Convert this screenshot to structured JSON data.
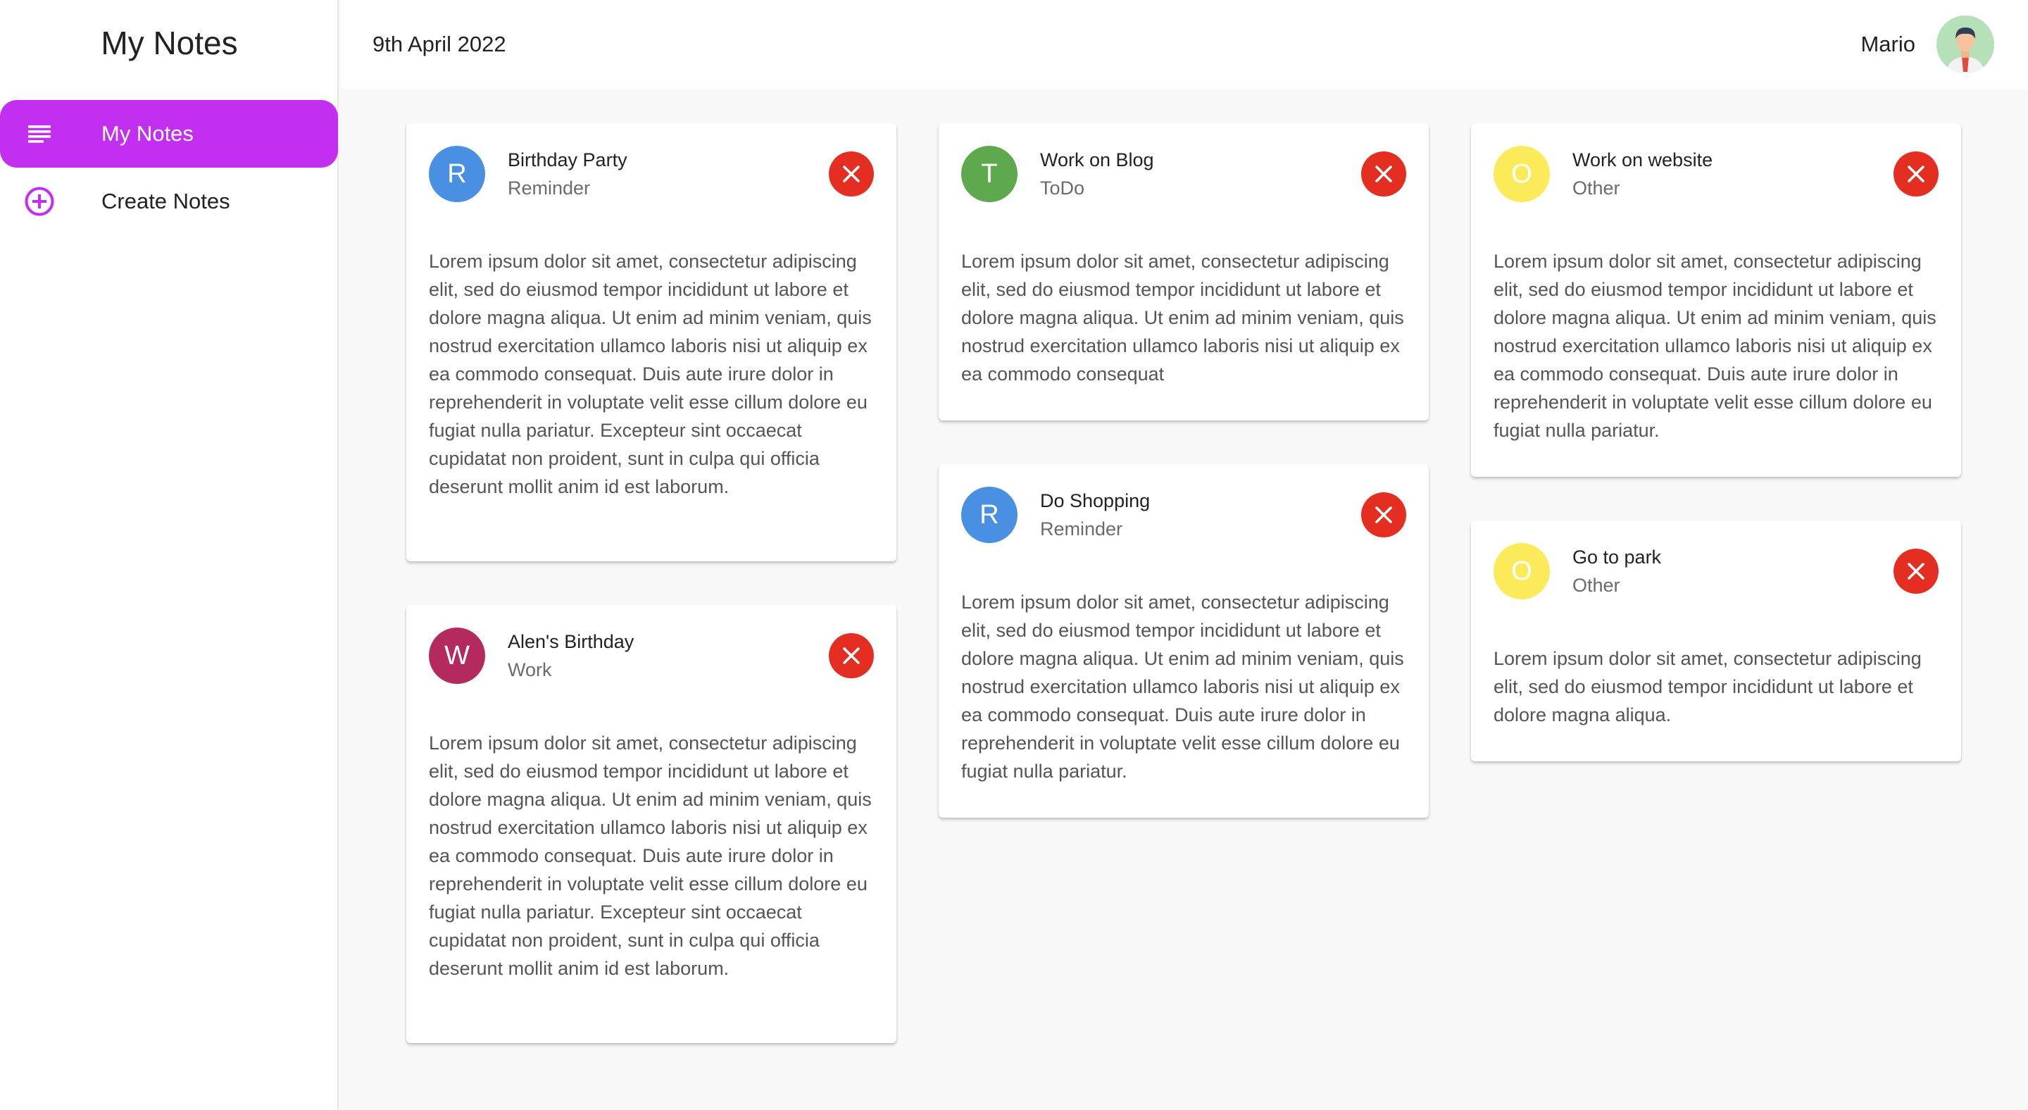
{
  "sidebar": {
    "title": "My Notes",
    "items": [
      {
        "label": "My Notes",
        "icon": "list-icon",
        "active": true
      },
      {
        "label": "Create Notes",
        "icon": "add-circle-icon",
        "active": false
      }
    ]
  },
  "header": {
    "date": "9th April 2022",
    "user_name": "Mario"
  },
  "colors": {
    "accent": "#c32ff0",
    "close": "#e42e21",
    "reminder": "#4a90e2",
    "todo": "#5ea84d",
    "other": "#fbea5a",
    "work": "#b52a5e"
  },
  "notes": [
    {
      "badge": "R",
      "title": "Birthday Party",
      "category": "Reminder",
      "body": "Lorem ipsum dolor sit amet, consectetur adipiscing elit, sed do eiusmod tempor incididunt ut labore et dolore magna aliqua. Ut enim ad minim veniam, quis nostrud exercitation ullamco laboris nisi ut aliquip ex ea commodo consequat. Duis aute irure dolor in reprehenderit in voluptate velit esse cillum dolore eu fugiat nulla pariatur. Excepteur sint occaecat cupidatat non proident, sunt in culpa qui officia deserunt mollit anim id est laborum."
    },
    {
      "badge": "W",
      "title": "Alen's Birthday",
      "category": "Work",
      "body": "Lorem ipsum dolor sit amet, consectetur adipiscing elit, sed do eiusmod tempor incididunt ut labore et dolore magna aliqua. Ut enim ad minim veniam, quis nostrud exercitation ullamco laboris nisi ut aliquip ex ea commodo consequat. Duis aute irure dolor in reprehenderit in voluptate velit esse cillum dolore eu fugiat nulla pariatur. Excepteur sint occaecat cupidatat non proident, sunt in culpa qui officia deserunt mollit anim id est laborum."
    },
    {
      "badge": "T",
      "title": "Work on Blog",
      "category": "ToDo",
      "body": "Lorem ipsum dolor sit amet, consectetur adipiscing elit, sed do eiusmod tempor incididunt ut labore et dolore magna aliqua. Ut enim ad minim veniam, quis nostrud exercitation ullamco laboris nisi ut aliquip ex ea commodo consequat"
    },
    {
      "badge": "R",
      "title": "Do Shopping",
      "category": "Reminder",
      "body": "Lorem ipsum dolor sit amet, consectetur adipiscing elit, sed do eiusmod tempor incididunt ut labore et dolore magna aliqua. Ut enim ad minim veniam, quis nostrud exercitation ullamco laboris nisi ut aliquip ex ea commodo consequat. Duis aute irure dolor in reprehenderit in voluptate velit esse cillum dolore eu fugiat nulla pariatur."
    },
    {
      "badge": "O",
      "title": "Work on website",
      "category": "Other",
      "body": "Lorem ipsum dolor sit amet, consectetur adipiscing elit, sed do eiusmod tempor incididunt ut labore et dolore magna aliqua. Ut enim ad minim veniam, quis nostrud exercitation ullamco laboris nisi ut aliquip ex ea commodo consequat. Duis aute irure dolor in reprehenderit in voluptate velit esse cillum dolore eu fugiat nulla pariatur."
    },
    {
      "badge": "O",
      "title": "Go to park",
      "category": "Other",
      "body": "Lorem ipsum dolor sit amet, consectetur adipiscing elit, sed do eiusmod tempor incididunt ut labore et dolore magna aliqua."
    }
  ]
}
